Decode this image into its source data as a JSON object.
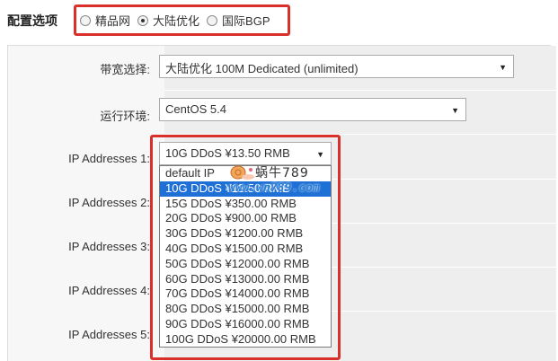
{
  "section_title": "配置选项",
  "plan_options": [
    {
      "label": "精品网",
      "checked": false
    },
    {
      "label": "大陆优化",
      "checked": true
    },
    {
      "label": "国际BGP",
      "checked": false
    }
  ],
  "fields": {
    "bandwidth": {
      "label": "带宽选择:",
      "value": "大陆优化 100M Dedicated (unlimited)"
    },
    "os": {
      "label": "运行环境:",
      "value": "CentOS 5.4"
    },
    "ip1": {
      "label": "IP Addresses 1:",
      "value": "10G DDoS ¥13.50 RMB"
    },
    "ip2": {
      "label": "IP Addresses 2:"
    },
    "ip3": {
      "label": "IP Addresses 3:"
    },
    "ip4": {
      "label": "IP Addresses 4:"
    },
    "ip5": {
      "label": "IP Addresses 5:"
    }
  },
  "ip_dropdown": {
    "options": [
      "default IP",
      "10G DDoS ¥13.50 RMB",
      "15G DDoS ¥350.00 RMB",
      "20G DDoS ¥900.00 RMB",
      "30G DDoS ¥1200.00 RMB",
      "40G DDoS ¥1500.00 RMB",
      "50G DDoS ¥12000.00 RMB",
      "60G DDoS ¥13000.00 RMB",
      "70G DDoS ¥14000.00 RMB",
      "80G DDoS ¥15000.00 RMB",
      "90G DDoS ¥16000.00 RMB",
      "100G DDoS ¥20000.00 RMB"
    ],
    "selected_index": 1
  },
  "watermark": {
    "name": "蜗牛789",
    "url": "www.wn789.com"
  },
  "icons": {
    "select_arrow": "chevron-down-icon",
    "radio": "radio-icon",
    "watermark_logo": "snail-logo"
  },
  "colors": {
    "highlight_border": "#d9302c",
    "selected_option": "#1e6fd6"
  }
}
